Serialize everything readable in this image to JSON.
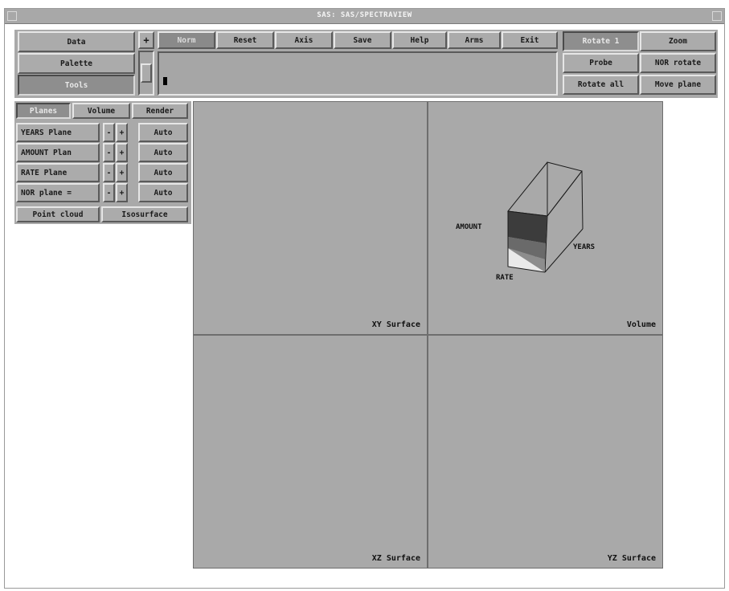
{
  "window": {
    "title": "SAS: SAS/SPECTRAVIEW"
  },
  "left_menu": [
    {
      "label": "Data",
      "active": false
    },
    {
      "label": "Palette",
      "active": false
    },
    {
      "label": "Tools",
      "active": true
    }
  ],
  "toolbar": {
    "plus_label": "+",
    "buttons": [
      "Norm",
      "Reset",
      "Axis",
      "Save",
      "Help",
      "Arms",
      "Exit"
    ]
  },
  "modes": [
    {
      "label": "Rotate 1",
      "active": true
    },
    {
      "label": "Zoom",
      "active": false
    },
    {
      "label": "Probe",
      "active": false
    },
    {
      "label": "NOR rotate",
      "active": false
    },
    {
      "label": "Rotate all",
      "active": false
    },
    {
      "label": "Move plane",
      "active": false
    }
  ],
  "tool_tabs": [
    {
      "label": "Planes",
      "active": true
    },
    {
      "label": "Volume",
      "active": false
    },
    {
      "label": "Render",
      "active": false
    }
  ],
  "planes": [
    {
      "name": "YEARS Plane",
      "minus": "-",
      "plus": "+",
      "auto": "Auto"
    },
    {
      "name": "AMOUNT Plan",
      "minus": "-",
      "plus": "+",
      "auto": "Auto"
    },
    {
      "name": "RATE Plane",
      "minus": "-",
      "plus": "+",
      "auto": "Auto"
    },
    {
      "name": "NOR plane =",
      "minus": "-",
      "plus": "+",
      "auto": "Auto"
    }
  ],
  "bottom_tools": [
    "Point cloud",
    "Isosurface"
  ],
  "views": {
    "xy": "XY Surface",
    "volume": "Volume",
    "xz": "XZ Surface",
    "yz": "YZ Surface"
  },
  "cube_axes": {
    "amount": "AMOUNT",
    "years": "YEARS",
    "rate": "RATE"
  },
  "colors": {
    "panel_gray": "#a9a9a9",
    "active_gray": "#8e8e8e"
  }
}
